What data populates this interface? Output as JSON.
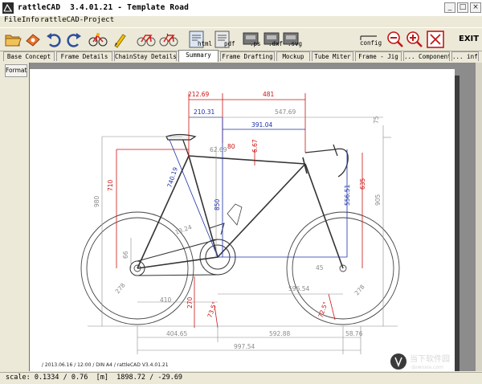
{
  "window": {
    "title": "rattleCAD  3.4.01.21 - Template Road",
    "controls": {
      "minimize": "_",
      "maximize": "□",
      "close": "×"
    }
  },
  "menu": [
    "File",
    "Info",
    "rattleCAD-Project"
  ],
  "toolbar": {
    "buttons": [
      {
        "icon": "open-folder-icon"
      },
      {
        "icon": "save-icon"
      },
      {
        "icon": "undo-icon"
      },
      {
        "icon": "redo-icon"
      },
      {
        "icon": "bike-render-icon"
      },
      {
        "icon": "highlight-icon"
      },
      {
        "icon": "bike-frame-icon"
      },
      {
        "icon": "bike-frame-alt-icon"
      },
      {
        "icon": "export-html-icon",
        "label": "html"
      },
      {
        "icon": "export-pdf-icon",
        "label": "pdf"
      },
      {
        "icon": "export-ps-icon",
        "label": ".ps"
      },
      {
        "icon": "export-dxf-icon",
        "label": ".dxf"
      },
      {
        "icon": "export-svg-icon",
        "label": ".svg"
      },
      {
        "icon": "config-icon",
        "label": "config"
      },
      {
        "icon": "zoom-out-icon"
      },
      {
        "icon": "zoom-in-icon"
      },
      {
        "icon": "fit-icon"
      }
    ],
    "exit_label": "EXIT"
  },
  "tabs": [
    {
      "label": "Base Concept",
      "active": false
    },
    {
      "label": "Frame Details",
      "active": false
    },
    {
      "label": "ChainStay Details",
      "active": false
    },
    {
      "label": "Summary",
      "active": true
    },
    {
      "label": "Frame Drafting",
      "active": false
    },
    {
      "label": "Mockup",
      "active": false
    },
    {
      "label": "Tube Miter",
      "active": false
    },
    {
      "label": "Frame - Jig",
      "active": false
    },
    {
      "label": "... Components",
      "active": false
    },
    {
      "label": "... info",
      "active": false
    }
  ],
  "format_button": "Format",
  "drawing": {
    "footer": "/  2013.06.16 / 12:00  /  DIN A4  /  rattleCAD   V3.4.01.21",
    "dimensions": {
      "d1": "212.69",
      "d2": "481",
      "d3": "210.31",
      "d4": "547.69",
      "d5": "391.04",
      "d6": "62.69",
      "d7": "80",
      "d8": "6.67",
      "d9": "75",
      "d10": "740.19",
      "d11": "710",
      "d12": "980",
      "d13": "850",
      "d14": "556.51",
      "d15": "635",
      "d16": "905",
      "d17": "13.24",
      "d18": "66",
      "d19": "45",
      "d20": "278",
      "d21": "410",
      "d22": "270",
      "d23": "73.5°",
      "d24": "596.54",
      "d25": "72.5°",
      "d26": "278",
      "d27": "404.65",
      "d28": "592.88",
      "d29": "58.76",
      "d30": "997.54"
    }
  },
  "status": "scale: 0.1334 / 0.76  [m]  1898.72 / -29.69",
  "watermark": {
    "line1": "当下软件园",
    "line2": "downxia.com"
  }
}
